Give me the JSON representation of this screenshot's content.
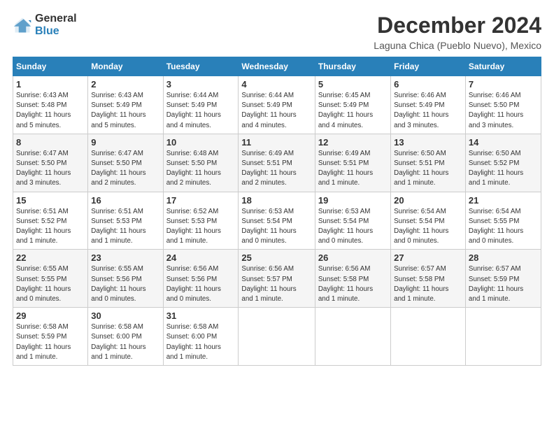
{
  "logo": {
    "general": "General",
    "blue": "Blue"
  },
  "title": {
    "month": "December 2024",
    "location": "Laguna Chica (Pueblo Nuevo), Mexico"
  },
  "headers": [
    "Sunday",
    "Monday",
    "Tuesday",
    "Wednesday",
    "Thursday",
    "Friday",
    "Saturday"
  ],
  "weeks": [
    [
      {
        "day": "1",
        "info": "Sunrise: 6:43 AM\nSunset: 5:48 PM\nDaylight: 11 hours\nand 5 minutes."
      },
      {
        "day": "2",
        "info": "Sunrise: 6:43 AM\nSunset: 5:49 PM\nDaylight: 11 hours\nand 5 minutes."
      },
      {
        "day": "3",
        "info": "Sunrise: 6:44 AM\nSunset: 5:49 PM\nDaylight: 11 hours\nand 4 minutes."
      },
      {
        "day": "4",
        "info": "Sunrise: 6:44 AM\nSunset: 5:49 PM\nDaylight: 11 hours\nand 4 minutes."
      },
      {
        "day": "5",
        "info": "Sunrise: 6:45 AM\nSunset: 5:49 PM\nDaylight: 11 hours\nand 4 minutes."
      },
      {
        "day": "6",
        "info": "Sunrise: 6:46 AM\nSunset: 5:49 PM\nDaylight: 11 hours\nand 3 minutes."
      },
      {
        "day": "7",
        "info": "Sunrise: 6:46 AM\nSunset: 5:50 PM\nDaylight: 11 hours\nand 3 minutes."
      }
    ],
    [
      {
        "day": "8",
        "info": "Sunrise: 6:47 AM\nSunset: 5:50 PM\nDaylight: 11 hours\nand 3 minutes."
      },
      {
        "day": "9",
        "info": "Sunrise: 6:47 AM\nSunset: 5:50 PM\nDaylight: 11 hours\nand 2 minutes."
      },
      {
        "day": "10",
        "info": "Sunrise: 6:48 AM\nSunset: 5:50 PM\nDaylight: 11 hours\nand 2 minutes."
      },
      {
        "day": "11",
        "info": "Sunrise: 6:49 AM\nSunset: 5:51 PM\nDaylight: 11 hours\nand 2 minutes."
      },
      {
        "day": "12",
        "info": "Sunrise: 6:49 AM\nSunset: 5:51 PM\nDaylight: 11 hours\nand 1 minute."
      },
      {
        "day": "13",
        "info": "Sunrise: 6:50 AM\nSunset: 5:51 PM\nDaylight: 11 hours\nand 1 minute."
      },
      {
        "day": "14",
        "info": "Sunrise: 6:50 AM\nSunset: 5:52 PM\nDaylight: 11 hours\nand 1 minute."
      }
    ],
    [
      {
        "day": "15",
        "info": "Sunrise: 6:51 AM\nSunset: 5:52 PM\nDaylight: 11 hours\nand 1 minute."
      },
      {
        "day": "16",
        "info": "Sunrise: 6:51 AM\nSunset: 5:53 PM\nDaylight: 11 hours\nand 1 minute."
      },
      {
        "day": "17",
        "info": "Sunrise: 6:52 AM\nSunset: 5:53 PM\nDaylight: 11 hours\nand 1 minute."
      },
      {
        "day": "18",
        "info": "Sunrise: 6:53 AM\nSunset: 5:54 PM\nDaylight: 11 hours\nand 0 minutes."
      },
      {
        "day": "19",
        "info": "Sunrise: 6:53 AM\nSunset: 5:54 PM\nDaylight: 11 hours\nand 0 minutes."
      },
      {
        "day": "20",
        "info": "Sunrise: 6:54 AM\nSunset: 5:54 PM\nDaylight: 11 hours\nand 0 minutes."
      },
      {
        "day": "21",
        "info": "Sunrise: 6:54 AM\nSunset: 5:55 PM\nDaylight: 11 hours\nand 0 minutes."
      }
    ],
    [
      {
        "day": "22",
        "info": "Sunrise: 6:55 AM\nSunset: 5:55 PM\nDaylight: 11 hours\nand 0 minutes."
      },
      {
        "day": "23",
        "info": "Sunrise: 6:55 AM\nSunset: 5:56 PM\nDaylight: 11 hours\nand 0 minutes."
      },
      {
        "day": "24",
        "info": "Sunrise: 6:56 AM\nSunset: 5:56 PM\nDaylight: 11 hours\nand 0 minutes."
      },
      {
        "day": "25",
        "info": "Sunrise: 6:56 AM\nSunset: 5:57 PM\nDaylight: 11 hours\nand 1 minute."
      },
      {
        "day": "26",
        "info": "Sunrise: 6:56 AM\nSunset: 5:58 PM\nDaylight: 11 hours\nand 1 minute."
      },
      {
        "day": "27",
        "info": "Sunrise: 6:57 AM\nSunset: 5:58 PM\nDaylight: 11 hours\nand 1 minute."
      },
      {
        "day": "28",
        "info": "Sunrise: 6:57 AM\nSunset: 5:59 PM\nDaylight: 11 hours\nand 1 minute."
      }
    ],
    [
      {
        "day": "29",
        "info": "Sunrise: 6:58 AM\nSunset: 5:59 PM\nDaylight: 11 hours\nand 1 minute."
      },
      {
        "day": "30",
        "info": "Sunrise: 6:58 AM\nSunset: 6:00 PM\nDaylight: 11 hours\nand 1 minute."
      },
      {
        "day": "31",
        "info": "Sunrise: 6:58 AM\nSunset: 6:00 PM\nDaylight: 11 hours\nand 1 minute."
      },
      null,
      null,
      null,
      null
    ]
  ]
}
